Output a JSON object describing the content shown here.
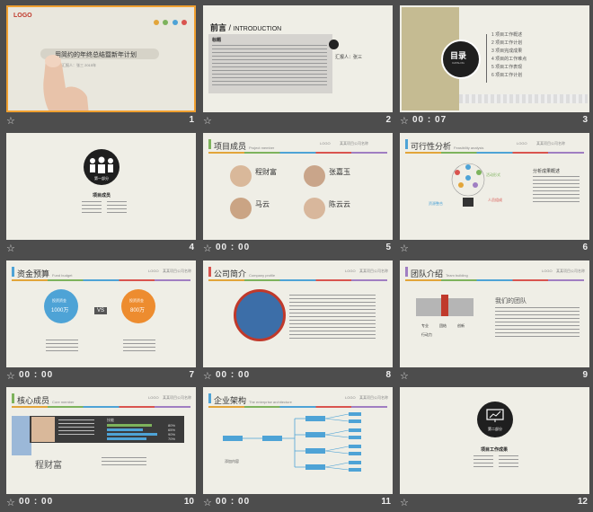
{
  "slides": [
    {
      "num": "1",
      "time": "",
      "title_bar": "用简约的年终总结暨新年计划",
      "logo": "LOGO",
      "subtitle": "汇报人：张三  2015年"
    },
    {
      "num": "2",
      "time": "",
      "title": "前言",
      "title_en": "INTRODUCTION",
      "subhead": "标题",
      "reporter": "汇报人：张三"
    },
    {
      "num": "3",
      "time": "00 : 07",
      "catalog": "目录",
      "catalog_en": "CATALOG",
      "items": [
        "1 项目工作概述",
        "2 项目工作计划",
        "3 项目完成成果",
        "4 项目的工作难点",
        "5 项目工作表现",
        "6 项目工作计划"
      ]
    },
    {
      "num": "4",
      "time": "",
      "part": "第一部分",
      "part_title": "项目成员"
    },
    {
      "num": "5",
      "time": "00 : 00",
      "title": "项目成员",
      "title_en": "Project member",
      "logo": "LOGO",
      "company": "某某项目公司名称",
      "members": [
        "程财富",
        "张嘉玉",
        "马云",
        "陈云云"
      ]
    },
    {
      "num": "6",
      "time": "",
      "title": "可行性分析",
      "title_en": "Feasibility analysis",
      "logo": "LOGO",
      "company": "某某项目公司名称",
      "heading": "分析成果概述",
      "labels": [
        "活动形式",
        "资源整合",
        "人员组成",
        "市场细分"
      ]
    },
    {
      "num": "7",
      "time": "00 : 00",
      "title": "资金预算",
      "title_en": "Fund budget",
      "logo": "LOGO",
      "company": "某某项目公司名称",
      "left_label": "投资资金",
      "left_value": "1000万",
      "vs": "VS",
      "right_label": "投资资金",
      "right_value": "800万"
    },
    {
      "num": "8",
      "time": "00 : 00",
      "title": "公司简介",
      "title_en": "Company profile",
      "logo": "LOGO",
      "company": "某某项目公司名称"
    },
    {
      "num": "9",
      "time": "",
      "title": "团队介绍",
      "title_en": "Team building",
      "logo": "LOGO",
      "company": "某某项目公司名称",
      "heading": "我们的团队",
      "bullets": [
        "专业",
        "团结",
        "创新",
        "行动力"
      ]
    },
    {
      "num": "10",
      "time": "00 : 00",
      "title": "核心成员",
      "title_en": "Core member",
      "logo": "LOGO",
      "company": "某某项目公司名称",
      "person": "程财富",
      "skills_title": "技能",
      "percents": [
        "80%",
        "65%",
        "90%",
        "70%"
      ]
    },
    {
      "num": "11",
      "time": "00 : 00",
      "title": "企业架构",
      "title_en": "The enterprise architecture",
      "logo": "LOGO",
      "company": "某某项目公司名称",
      "left_note": "添加内容"
    },
    {
      "num": "12",
      "time": "",
      "part": "第二部分",
      "part_title": "项目工作成果"
    }
  ]
}
